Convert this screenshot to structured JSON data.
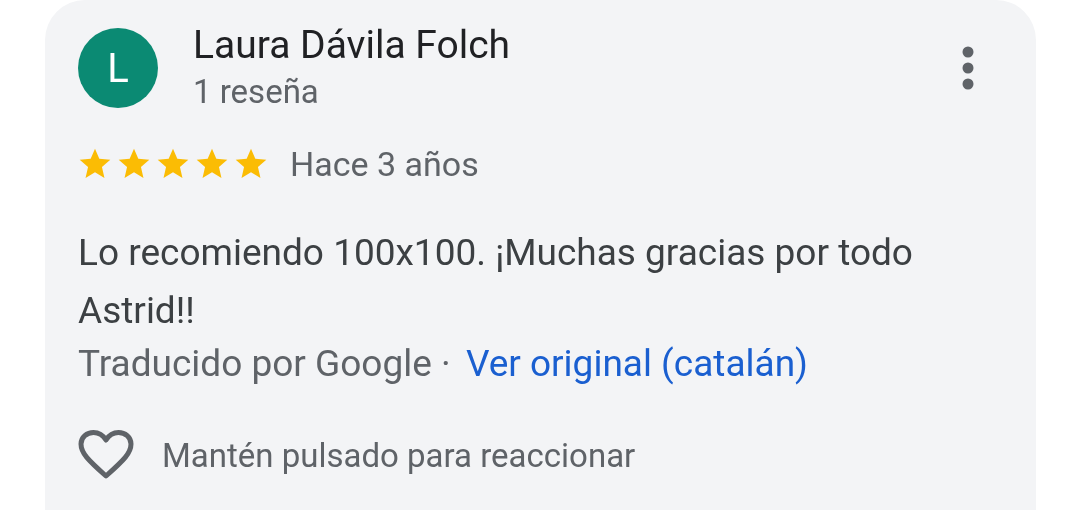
{
  "review": {
    "avatar_letter": "L",
    "author": "Laura Dávila Folch",
    "review_count": "1 reseña",
    "stars": 5,
    "time": "Hace 3 años",
    "text": "Lo recomiendo 100x100. ¡Muchas gracias por todo Astrid!!",
    "translation_note": "Traducido por Google ·",
    "original_link": "Ver original (catalán)",
    "reaction_hint": "Mantén pulsado para reaccionar"
  }
}
